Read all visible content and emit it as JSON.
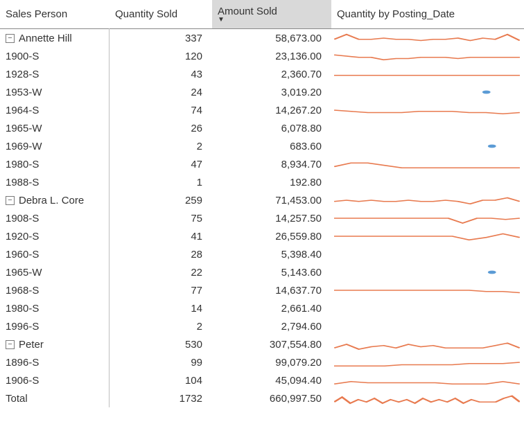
{
  "columns": {
    "person": "Sales Person",
    "qty": "Quantity Sold",
    "amount": "Amount Sold",
    "spark": "Quantity by Posting_Date"
  },
  "sort": {
    "column": "amount",
    "dir": "desc"
  },
  "colors": {
    "sparkline": "#e87a4f",
    "dot": "#5b9bd5",
    "header_selected_bg": "#d9d9d9"
  },
  "groups": [
    {
      "name": "Annette Hill",
      "expanded": true,
      "qty": "337",
      "amount": "58,673.00",
      "spark": {
        "type": "line",
        "points": [
          6,
          2,
          6,
          6,
          5,
          6,
          6,
          7,
          6,
          6,
          5,
          7,
          5,
          6,
          2,
          7
        ]
      },
      "children": [
        {
          "name": "1900-S",
          "qty": "120",
          "amount": "23,136.00",
          "spark": {
            "type": "line",
            "points": [
              4,
              5,
              6,
              6,
              8,
              7,
              7,
              6,
              6,
              6,
              7,
              6,
              6,
              6,
              6,
              6
            ]
          }
        },
        {
          "name": "1928-S",
          "qty": "43",
          "amount": "2,360.70",
          "spark": {
            "type": "line",
            "points": [
              6,
              6,
              6,
              6,
              6,
              6
            ]
          }
        },
        {
          "name": "1953-W",
          "qty": "24",
          "amount": "3,019.20",
          "spark": {
            "type": "dot",
            "x": 0.82
          }
        },
        {
          "name": "1964-S",
          "qty": "74",
          "amount": "14,267.20",
          "spark": {
            "type": "line",
            "points": [
              5,
              6,
              7,
              7,
              7,
              6,
              6,
              6,
              7,
              7,
              8,
              7
            ]
          }
        },
        {
          "name": "1965-W",
          "qty": "26",
          "amount": "6,078.80",
          "spark": null
        },
        {
          "name": "1969-W",
          "qty": "2",
          "amount": "683.60",
          "spark": {
            "type": "dot",
            "x": 0.85
          }
        },
        {
          "name": "1980-S",
          "qty": "47",
          "amount": "8,934.70",
          "spark": {
            "type": "line",
            "points": [
              7,
              4,
              4,
              6,
              8,
              8,
              8,
              8,
              8,
              8,
              8,
              8
            ]
          }
        },
        {
          "name": "1988-S",
          "qty": "1",
          "amount": "192.80",
          "spark": null
        }
      ]
    },
    {
      "name": "Debra L. Core",
      "expanded": true,
      "qty": "259",
      "amount": "71,453.00",
      "spark": {
        "type": "line",
        "points": [
          6,
          5,
          6,
          5,
          6,
          6,
          5,
          6,
          6,
          5,
          6,
          8,
          5,
          5,
          3,
          6
        ]
      },
      "children": [
        {
          "name": "1908-S",
          "qty": "75",
          "amount": "14,257.50",
          "spark": {
            "type": "line",
            "points": [
              5,
              5,
              5,
              5,
              5,
              5,
              5,
              5,
              5,
              9,
              5,
              5,
              6,
              5
            ]
          }
        },
        {
          "name": "1920-S",
          "qty": "41",
          "amount": "26,559.80",
          "spark": {
            "type": "line",
            "points": [
              5,
              5,
              5,
              5,
              5,
              5,
              5,
              5,
              8,
              6,
              3,
              6
            ]
          }
        },
        {
          "name": "1960-S",
          "qty": "28",
          "amount": "5,398.40",
          "spark": null
        },
        {
          "name": "1965-W",
          "qty": "22",
          "amount": "5,143.60",
          "spark": {
            "type": "dot",
            "x": 0.85
          }
        },
        {
          "name": "1968-S",
          "qty": "77",
          "amount": "14,637.70",
          "spark": {
            "type": "line",
            "points": [
              5,
              5,
              5,
              5,
              5,
              5,
              5,
              5,
              5,
              6,
              6,
              7
            ]
          }
        },
        {
          "name": "1980-S",
          "qty": "14",
          "amount": "2,661.40",
          "spark": null
        },
        {
          "name": "1996-S",
          "qty": "2",
          "amount": "2,794.60",
          "spark": null
        }
      ]
    },
    {
      "name": "Peter",
      "expanded": true,
      "qty": "530",
      "amount": "307,554.80",
      "spark": {
        "type": "line",
        "points": [
          8,
          5,
          9,
          7,
          6,
          8,
          5,
          7,
          6,
          8,
          8,
          8,
          8,
          6,
          4,
          8
        ]
      },
      "children": [
        {
          "name": "1896-S",
          "qty": "99",
          "amount": "99,079.20",
          "spark": {
            "type": "line",
            "points": [
              8,
              8,
              8,
              8,
              7,
              7,
              7,
              7,
              6,
              6,
              6,
              5
            ]
          }
        },
        {
          "name": "1906-S",
          "qty": "104",
          "amount": "45,094.40",
          "spark": {
            "type": "line",
            "points": [
              8,
              6,
              7,
              7,
              7,
              7,
              7,
              8,
              8,
              8,
              6,
              8
            ]
          }
        }
      ]
    }
  ],
  "total": {
    "label": "Total",
    "qty": "1732",
    "amount": "660,997.50",
    "spark": {
      "type": "line",
      "points": [
        8,
        4,
        9,
        6,
        8,
        5,
        9,
        6,
        8,
        6,
        9,
        5,
        8,
        6,
        8,
        5,
        9,
        6,
        8,
        8,
        8,
        5,
        3,
        8
      ]
    }
  }
}
